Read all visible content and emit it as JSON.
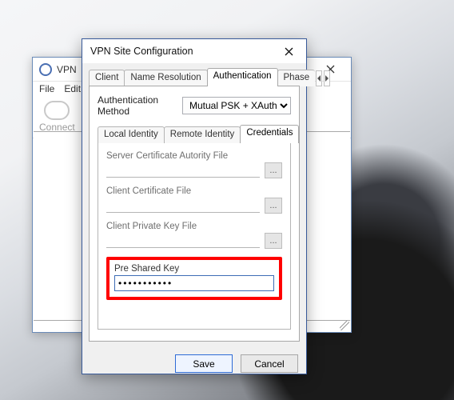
{
  "bg": {
    "title": "VPN",
    "menu": [
      "File",
      "Edit"
    ],
    "tool_connect": "Connect"
  },
  "dlg": {
    "title": "VPN Site Configuration",
    "outer_tabs": [
      {
        "label": "Client"
      },
      {
        "label": "Name Resolution"
      },
      {
        "label": "Authentication",
        "active": true
      },
      {
        "label": "Phase"
      }
    ],
    "auth_method_label": "Authentication Method",
    "auth_method_value": "Mutual PSK + XAuth",
    "sub_tabs": [
      {
        "label": "Local Identity"
      },
      {
        "label": "Remote Identity"
      },
      {
        "label": "Credentials",
        "active": true
      }
    ],
    "fields": {
      "server_ca_label": "Server Certificate Autority File",
      "server_ca_value": "",
      "client_cert_label": "Client Certificate File",
      "client_cert_value": "",
      "client_key_label": "Client Private Key File",
      "client_key_value": "",
      "psk_label": "Pre Shared Key",
      "psk_value": "●●●●●●●●●●●"
    },
    "browse_label": "...",
    "save_label": "Save",
    "cancel_label": "Cancel"
  }
}
